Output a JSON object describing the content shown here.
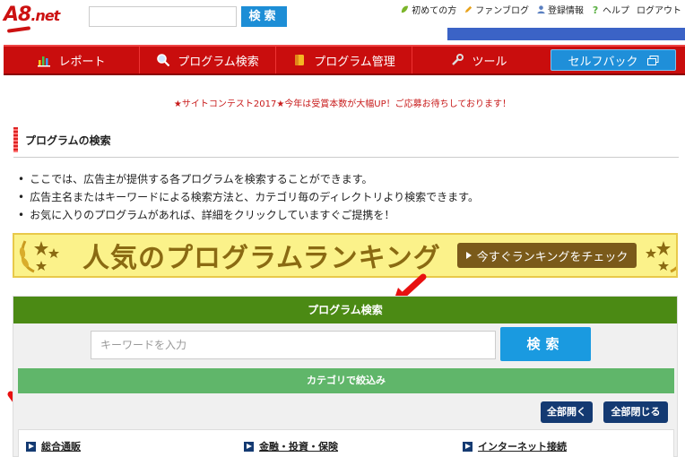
{
  "header": {
    "logo_text": "A8",
    "logo_suffix": ".net",
    "search_button": "検索",
    "util_links": [
      {
        "label": "初めての方",
        "icon": "leaf-icon"
      },
      {
        "label": "ファンブログ",
        "icon": "pencil-icon"
      },
      {
        "label": "登録情報",
        "icon": "user-icon"
      },
      {
        "label": "ヘルプ",
        "icon": "question-icon"
      },
      {
        "label": "ログアウト",
        "icon": ""
      }
    ]
  },
  "nav": {
    "items": [
      {
        "label": "レポート",
        "icon": "chart-icon"
      },
      {
        "label": "プログラム検索",
        "icon": "magnifier-icon"
      },
      {
        "label": "プログラム管理",
        "icon": "tag-icon"
      },
      {
        "label": "ツール",
        "icon": "wrench-icon"
      }
    ],
    "selfback": "セルフバック",
    "selfback_icon": "window-icon"
  },
  "campaign_notice": "★サイトコンテスト2017★今年は受賞本数が大幅UP！ご応募お待ちしております！",
  "section": {
    "title": "プログラムの検索",
    "bullets": [
      "ここでは、広告主が提供する各プログラムを検索することができます。",
      "広告主名またはキーワードによる検索方法と、カテゴリ毎のディレクトリより検索できます。",
      "お気に入りのプログラムがあれば、詳細をクリックしていますぐご提携を！"
    ]
  },
  "banner": {
    "headline": "人気のプログラムランキング",
    "cta": "今すぐランキングをチェック"
  },
  "program_search": {
    "title": "プログラム検索",
    "keyword_placeholder": "キーワードを入力",
    "search_button": "検索",
    "category_bar": "カテゴリで絞込み",
    "open_all": "全部開く",
    "close_all": "全部閉じる",
    "categories": [
      "総合通販",
      "金融・投資・保険",
      "インターネット接続"
    ]
  },
  "colors": {
    "brand_red": "#c90d0d",
    "accent_blue": "#1d8ed6",
    "panel_green": "#4b8a14",
    "category_green": "#60b66a",
    "navy": "#143a72"
  }
}
